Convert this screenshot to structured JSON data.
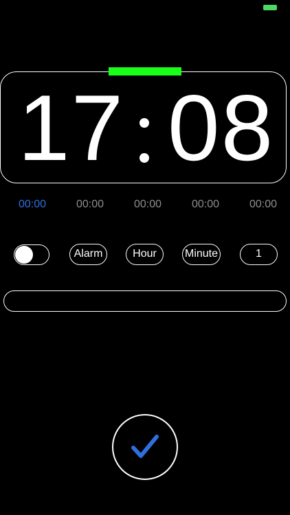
{
  "status_bar": {
    "battery_color": "#4cd964"
  },
  "clock": {
    "hours": "17",
    "minutes": "08",
    "indicator_color": "#1aff1a"
  },
  "alarms": [
    {
      "time": "00:00",
      "active": true
    },
    {
      "time": "00:00",
      "active": false
    },
    {
      "time": "00:00",
      "active": false
    },
    {
      "time": "00:00",
      "active": false
    },
    {
      "time": "00:00",
      "active": false
    }
  ],
  "controls": {
    "toggle_on": false,
    "alarm_label": "Alarm",
    "hour_label": "Hour",
    "minute_label": "Minute",
    "count_label": "1"
  },
  "text_field": {
    "value": ""
  },
  "confirm": {
    "icon": "checkmark-icon",
    "color": "#2f6fe0"
  },
  "colors": {
    "accent": "#2f6fe0",
    "inactive_text": "#8e8e8e",
    "background": "#000000"
  }
}
